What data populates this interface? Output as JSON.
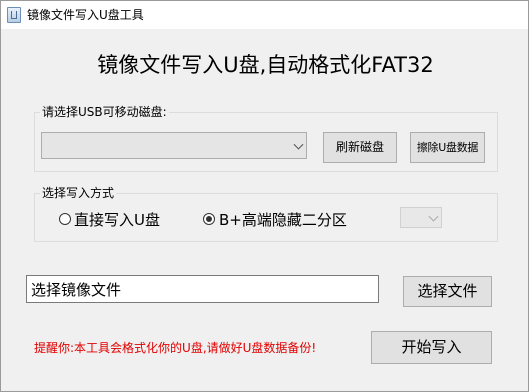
{
  "window": {
    "title": "镜像文件写入U盘工具"
  },
  "heading": "镜像文件写入U盘,自动格式化FAT32",
  "usb_group": {
    "label": "请选择USB可移动磁盘:",
    "disk_select_value": "",
    "refresh_button": "刷新磁盘",
    "erase_button": "擦除U盘数据"
  },
  "mode_group": {
    "label": "选择写入方式",
    "options": [
      {
        "label": "直接写入U盘",
        "checked": false
      },
      {
        "label": "B+高端隐藏二分区",
        "checked": true
      }
    ],
    "partition_select_value": ""
  },
  "image": {
    "path_value": "选择镜像文件",
    "choose_button": "选择文件"
  },
  "warning": "提醒你:本工具会格式化你的U盘,请做好U盘数据备份!",
  "start_button": "开始写入"
}
